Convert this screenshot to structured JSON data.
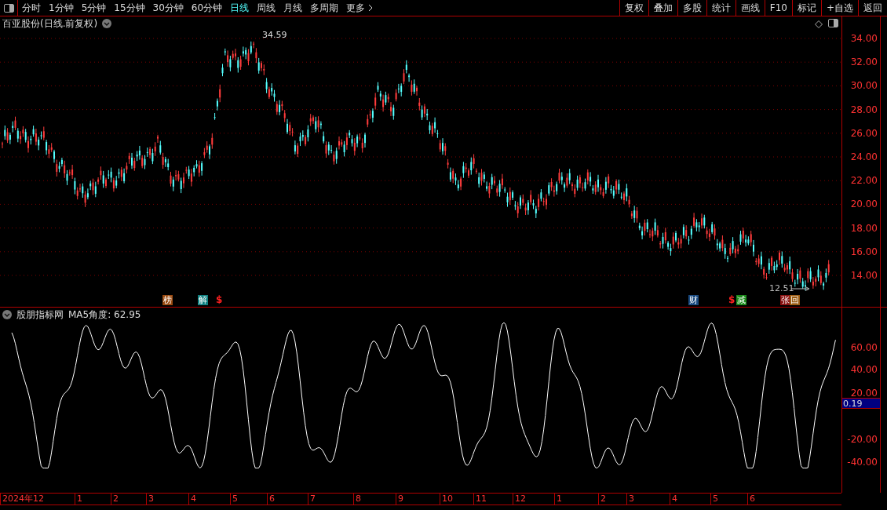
{
  "toolbar": {
    "periods": [
      {
        "label": "分时",
        "selected": false
      },
      {
        "label": "1分钟",
        "selected": false
      },
      {
        "label": "5分钟",
        "selected": false
      },
      {
        "label": "15分钟",
        "selected": false
      },
      {
        "label": "30分钟",
        "selected": false
      },
      {
        "label": "60分钟",
        "selected": false
      },
      {
        "label": "日线",
        "selected": true
      },
      {
        "label": "周线",
        "selected": false
      },
      {
        "label": "月线",
        "selected": false
      },
      {
        "label": "多周期",
        "selected": false
      },
      {
        "label": "更多",
        "selected": false
      }
    ],
    "actions": [
      "复权",
      "叠加",
      "多股",
      "统计",
      "画线",
      "F10",
      "标记",
      "+自选",
      "返回"
    ]
  },
  "main_chart": {
    "title": "百亚股份(日线.前复权)",
    "high_label": "34.59",
    "low_label": "12.51",
    "y_ticks": [
      "34.00",
      "32.00",
      "30.00",
      "28.00",
      "26.00",
      "24.00",
      "22.00",
      "20.00",
      "18.00",
      "16.00",
      "14.00"
    ],
    "markers": [
      {
        "kind": "badge",
        "text": "榜",
        "color": "#9a4a10"
      },
      {
        "kind": "badge",
        "text": "解",
        "color": "#0f8080"
      },
      {
        "kind": "dollar",
        "text": "$",
        "color": "#ff2020"
      },
      {
        "kind": "badge",
        "text": "财",
        "color": "#1a4a80"
      },
      {
        "kind": "dollar",
        "text": "$",
        "color": "#ff2020"
      },
      {
        "kind": "badge",
        "text": "减",
        "color": "#1a8a1a"
      },
      {
        "kind": "badge",
        "text": "张",
        "color": "#8a1010"
      },
      {
        "kind": "badge",
        "text": "回",
        "color": "#9a5a10"
      }
    ]
  },
  "indicator": {
    "title": "股朋指标网",
    "reading": "MA5角度: 62.95",
    "y_ticks": [
      "60.00",
      "40.00",
      "20.00",
      "-20.00",
      "-40.00"
    ],
    "cursor_value": "0.19"
  },
  "date_axis": [
    "2024年12",
    "1",
    "2",
    "3",
    "4",
    "5",
    "6",
    "7",
    "8",
    "9",
    "10",
    "11",
    "12",
    "1",
    "2",
    "3",
    "4",
    "5",
    "6"
  ]
}
